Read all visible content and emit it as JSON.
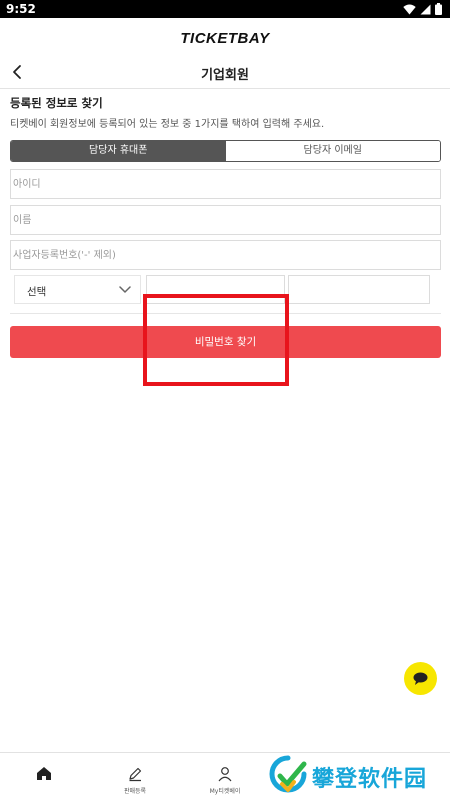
{
  "status_bar": {
    "time": "9:52",
    "icons": [
      "wifi-icon",
      "signal-icon",
      "battery-icon"
    ]
  },
  "brand": {
    "logo_text": "TICKETBAY"
  },
  "header": {
    "title": "기업회원",
    "back_icon": "chevron-left-icon"
  },
  "section": {
    "heading": "등록된 정보로 찾기",
    "description": "티켓베이 회원정보에 등록되어 있는 정보 중 1가지를 택하여 입력해 주세요."
  },
  "tabs": [
    {
      "label": "담당자 휴대폰",
      "active": true
    },
    {
      "label": "담당자 이메일",
      "active": false
    }
  ],
  "form": {
    "id_placeholder": "아이디",
    "name_placeholder": "이름",
    "business_number_placeholder": "사업자등록번호('-' 제외)",
    "phone": {
      "prefix_selected": "선택",
      "middle_value": "",
      "last_value": ""
    }
  },
  "submit_label": "비밀번호 찾기",
  "chat_button": {
    "icon": "chat-bubble-icon",
    "color": "#f7e600"
  },
  "bottom_nav": {
    "items": [
      {
        "label": "",
        "icon": "home-icon"
      },
      {
        "label": "판매등록",
        "icon": "pencil-icon"
      },
      {
        "label": "My티켓베이",
        "icon": "user-icon"
      }
    ]
  },
  "watermark": {
    "text": "攀登软件园"
  },
  "colors": {
    "accent_red": "#ef4a4f",
    "tab_active_bg": "#555555",
    "highlight_red": "#e8141c",
    "watermark_blue": "#18a6d9"
  }
}
